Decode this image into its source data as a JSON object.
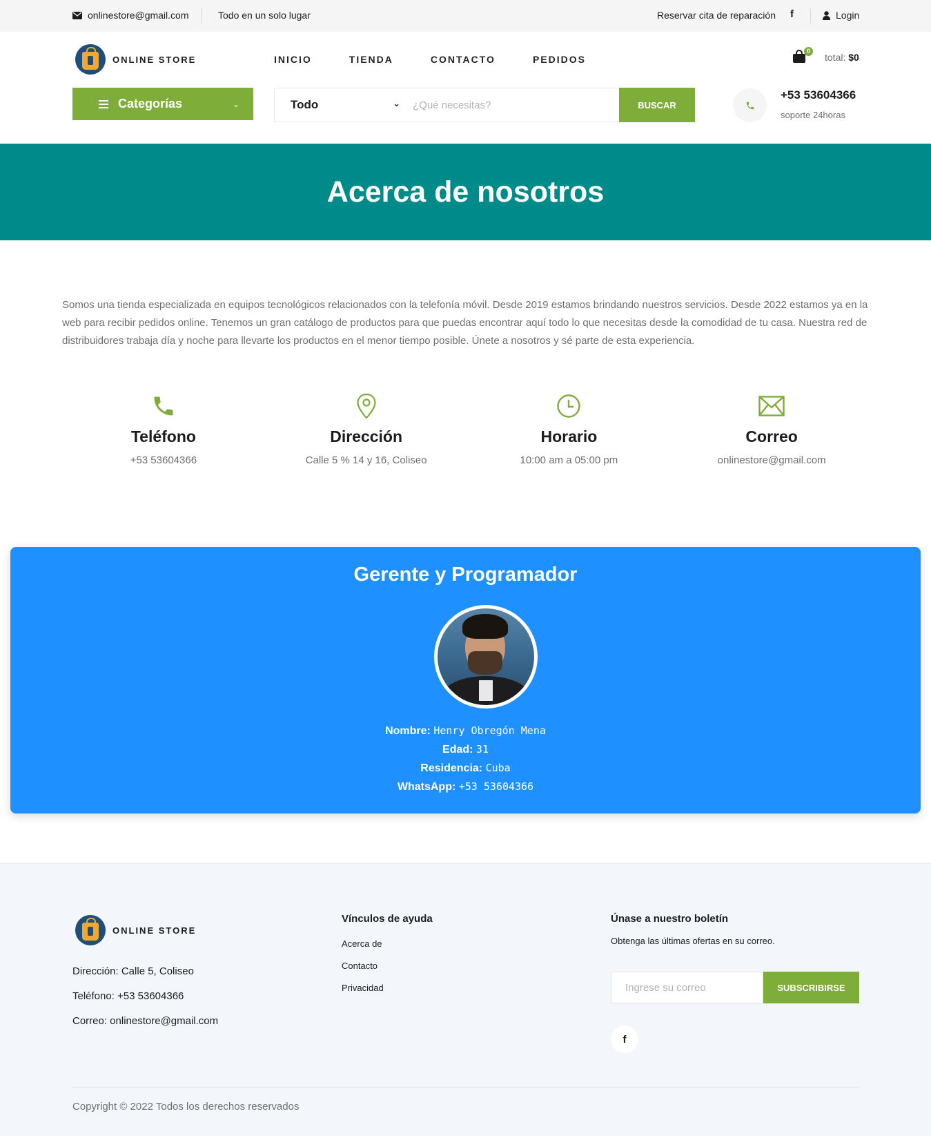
{
  "topbar": {
    "email": "onlinestore@gmail.com",
    "slogan": "Todo en un solo lugar",
    "repair": "Reservar cita de reparación",
    "facebook_glyph": "f",
    "login": "Login"
  },
  "header": {
    "logo_text": "ONLINE STORE",
    "nav": [
      "INICIO",
      "TIENDA",
      "CONTACTO",
      "PEDIDOS"
    ],
    "cart_count": "0",
    "total_label": "total:",
    "total_value": "$0",
    "categories_label": "Categorías",
    "search": {
      "category": "Todo",
      "placeholder": "¿Qué necesitas?",
      "button": "BUSCAR"
    },
    "phone": "+53 53604366",
    "phone_sub": "soporte 24horas"
  },
  "banner": {
    "title": "Acerca de nosotros"
  },
  "about": {
    "text": "Somos una tienda especializada en equipos tecnológicos relacionados con la telefonía móvil. Desde 2019 estamos brindando nuestros servicios. Desde 2022 estamos ya en la web para recibir pedidos online. Tenemos un gran catálogo de productos para que puedas encontrar aquí todo lo que necesitas desde la comodidad de tu casa. Nuestra red de distribuidores trabaja día y noche para llevarte los productos en el menor tiempo posible. Únete a nosotros y sé parte de esta experiencia.",
    "info": [
      {
        "icon": "phone-icon",
        "title": "Teléfono",
        "value": "+53 53604366"
      },
      {
        "icon": "map-pin-icon",
        "title": "Dirección",
        "value": "Calle 5 % 14 y 16, Coliseo"
      },
      {
        "icon": "clock-icon",
        "title": "Horario",
        "value": "10:00 am a 05:00 pm"
      },
      {
        "icon": "envelope-icon",
        "title": "Correo",
        "value": "onlinestore@gmail.com"
      }
    ]
  },
  "manager": {
    "title": "Gerente y Programador",
    "rows": [
      {
        "label": "Nombre:",
        "value": "Henry Obregón Mena"
      },
      {
        "label": "Edad:",
        "value": "31"
      },
      {
        "label": "Residencia:",
        "value": "Cuba"
      },
      {
        "label": "WhatsApp:",
        "value": "+53 53604366"
      }
    ]
  },
  "footer": {
    "logo_text": "ONLINE STORE",
    "address": "Dirección: Calle 5, Coliseo",
    "phone": "Teléfono: +53 53604366",
    "email": "Correo: onlinestore@gmail.com",
    "links_title": "Vínculos de ayuda",
    "links": [
      "Acerca de",
      "Contacto",
      "Privacidad"
    ],
    "newsletter_title": "Únase a nuestro boletín",
    "newsletter_text": "Obtenga las últimas ofertas en su correo.",
    "newsletter_placeholder": "Ingrese su correo",
    "newsletter_button": "SUBSCRIBIRSE",
    "facebook_glyph": "f",
    "copyright": "Copyright © 2022 Todos los derechos reservados"
  },
  "colors": {
    "accent_green": "#7fad39",
    "banner_teal": "#008b8b",
    "card_blue": "#1e90ff"
  }
}
